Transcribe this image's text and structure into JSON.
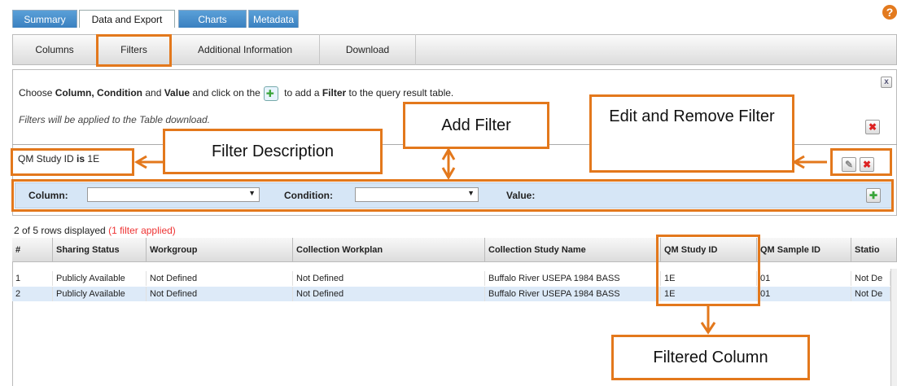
{
  "tabs": [
    {
      "label": "Summary",
      "active": false
    },
    {
      "label": "Data and Export",
      "active": true
    },
    {
      "label": "Charts",
      "active": false
    },
    {
      "label": "Metadata",
      "active": false
    }
  ],
  "subtabs": [
    "Columns",
    "Filters",
    "Additional Information",
    "Download"
  ],
  "instruction": {
    "part1": "Choose ",
    "b1": "Column, Condition",
    "part2": " and ",
    "b2": "Value",
    "part3": " and click on the",
    "part4": " to add a ",
    "b3": "Filter",
    "part5": " to the query result table."
  },
  "note": "Filters will be applied to the Table download.",
  "filter_desc": {
    "field": "QM Study ID",
    "op": "is",
    "value": "1E"
  },
  "filter_form": {
    "column_label": "Column:",
    "condition_label": "Condition:",
    "value_label": "Value:",
    "column_value": "",
    "condition_value": ""
  },
  "rowcount": {
    "text": "2 of 5 rows displayed",
    "applied": "(1 filter applied)"
  },
  "table": {
    "headers": [
      "#",
      "Sharing Status",
      "Workgroup",
      "Collection Workplan",
      "Collection Study Name",
      "QM Study ID",
      "QM Sample ID",
      "Statio"
    ],
    "rows": [
      [
        "1",
        "Publicly Available",
        "Not Defined",
        "Not Defined",
        "Buffalo River USEPA 1984 BASS",
        "1E",
        "01",
        "Not De"
      ],
      [
        "2",
        "Publicly Available",
        "Not Defined",
        "Not Defined",
        "Buffalo River USEPA 1984 BASS",
        "1E",
        "01",
        "Not De"
      ]
    ]
  },
  "annotations": {
    "filter_description": "Filter Description",
    "add_filter": "Add Filter",
    "edit_remove": "Edit and Remove Filter",
    "filtered_column": "Filtered Column"
  },
  "icons": {
    "help": "?",
    "close": "x",
    "remove": "✖",
    "edit": "✎",
    "add": "✚",
    "dropdown": "▼"
  },
  "colors": {
    "accent": "#e3781c",
    "tab_blue": "#3a80c0",
    "filter_row": "#d6e6f6",
    "alert": "#e33333"
  }
}
